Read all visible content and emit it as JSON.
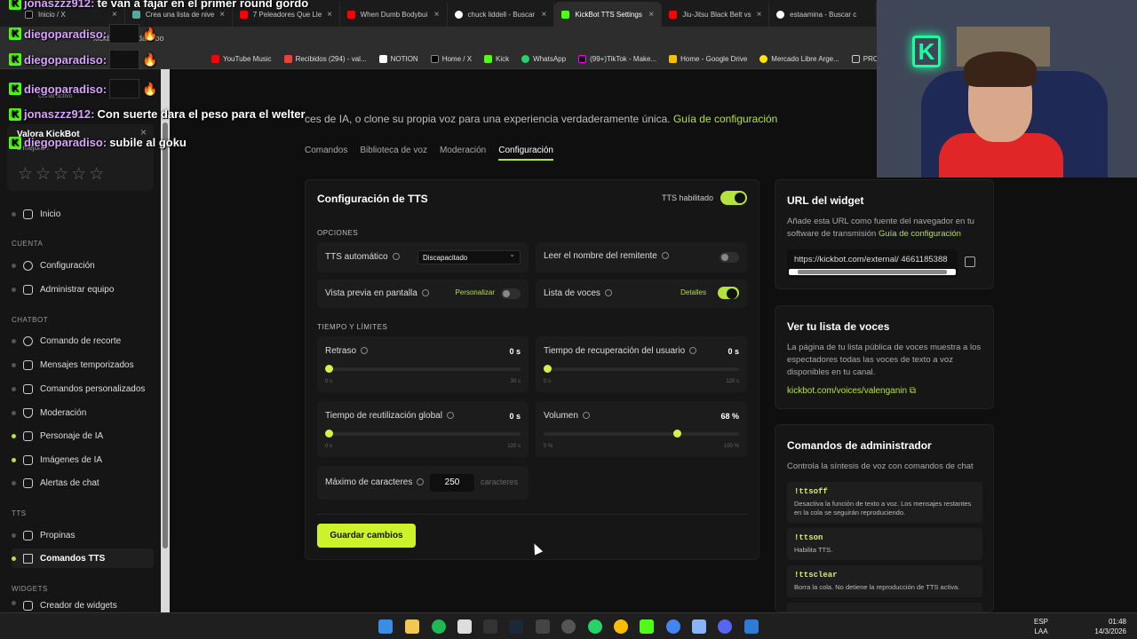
{
  "browser": {
    "tabs": [
      "Inicio / X",
      "Crea una lista de nive",
      "7 Peleadores Que Lle",
      "When Dumb Bodybui",
      "chuck liddell - Buscar",
      "KickBot TTS Settings",
      "Jiu-Jitsu Black Belt vs",
      "estaamina - Buscar c"
    ],
    "url": "kickbot.com/dashbo",
    "bookmarks": [
      "YouTube Music",
      "Recibidos (294) - val...",
      "NOTION",
      "Home / X",
      "Kick",
      "WhatsApp",
      "(99+)TikTok - Make...",
      "Home - Google Drive",
      "Mercado Libre Arge...",
      "PROG"
    ]
  },
  "chat": [
    {
      "user": "jonaszzz912:",
      "msg": "te van a fajar en el primer round gordo"
    },
    {
      "user": "diegoparadiso:",
      "msg": ""
    },
    {
      "user": "diegoparadiso:",
      "msg": ""
    },
    {
      "user": "diegoparadiso:",
      "msg": ""
    },
    {
      "user": "jonaszzz912:",
      "msg": "Con suerte dara el peso para el welter"
    },
    {
      "user": "diegoparadiso:",
      "msg": "subile al goku"
    }
  ],
  "sidebar": {
    "channel_status": "Canal activo",
    "rate_title": "Valora KickBot",
    "rate_sub": "a mejorar!",
    "stars": "☆☆☆☆☆",
    "home": "Inicio",
    "sec_account": "CUENTA",
    "account": [
      "Configuración",
      "Administrar equipo"
    ],
    "sec_chatbot": "CHATBOT",
    "chatbot": [
      "Comando de recorte",
      "Mensajes temporizados",
      "Comandos personalizados",
      "Moderación",
      "Personaje de IA",
      "Imágenes de IA",
      "Alertas de chat"
    ],
    "sec_tts": "TTS",
    "tts": [
      "Propinas",
      "Comandos TTS"
    ],
    "sec_widgets": "WIDGETS",
    "widgets": [
      "Creador de widgets"
    ]
  },
  "main": {
    "intro": "ces de IA, o clone su propia voz para una experiencia verdaderamente única.",
    "intro_link": "Guía de configuración",
    "tabs": [
      "Comandos",
      "Biblioteca de voz",
      "Moderación",
      "Configuración"
    ],
    "panel_title": "Configuración de TTS",
    "tts_enabled_label": "TTS habilitado",
    "options_label": "OPCIONES",
    "auto_tts": "TTS automático",
    "auto_tts_value": "Discapacitado",
    "read_sender": "Leer el nombre del remitente",
    "preview": "Vista previa en pantalla",
    "customize": "Personalizar",
    "voice_list": "Lista de voces",
    "details": "Detalles",
    "limits_label": "TIEMPO Y LÍMITES",
    "delay": "Retraso",
    "delay_val": "0 s",
    "delay_min": "0 s",
    "delay_max": "30 s",
    "user_cd": "Tiempo de recuperación del usuario",
    "user_cd_val": "0 s",
    "user_cd_min": "0 s",
    "user_cd_max": "120 s",
    "global_cd": "Tiempo de reutilización global",
    "global_cd_val": "0 s",
    "global_cd_min": "0 s",
    "global_cd_max": "120 s",
    "volume": "Volumen",
    "volume_val": "68 %",
    "volume_min": "0 %",
    "volume_max": "100 %",
    "max_chars": "Máximo de caracteres",
    "max_chars_val": "250",
    "chars_unit": "caracteres",
    "save": "Guardar cambios"
  },
  "right": {
    "widget_title": "URL del widget",
    "widget_desc": "Añade esta URL como fuente del navegador en tu software de transmisión",
    "widget_link": "Guía de configuración",
    "widget_url": "https://kickbot.com/external/ 4661185388",
    "voices_title": "Ver tu lista de voces",
    "voices_desc": "La página de tu lista pública de voces muestra a los espectadores todas las voces de texto a voz disponibles en tu canal.",
    "voices_link": "kickbot.com/voices/valenganin",
    "admin_title": "Comandos de administrador",
    "admin_desc": "Controla la síntesis de voz con comandos de chat",
    "commands": [
      {
        "cmd": "!ttsoff",
        "desc": "Desactiva la función de texto a voz. Los mensajes restantes en la cola se seguirán reproduciendo."
      },
      {
        "cmd": "!ttson",
        "desc": "Habilita TTS."
      },
      {
        "cmd": "!ttsclear",
        "desc": "Borra la cola. No detiene la reproducción de TTS activa."
      }
    ]
  },
  "taskbar": {
    "lang1": "ESP",
    "lang2": "LAA",
    "time": "01:48",
    "date": "14/3/2026"
  },
  "colors": {
    "accent": "#b4e33d",
    "button": "#ccf22b"
  },
  "sliders": {
    "delay": 0,
    "user_cd": 0,
    "global_cd": 0,
    "volume": 0.68
  }
}
